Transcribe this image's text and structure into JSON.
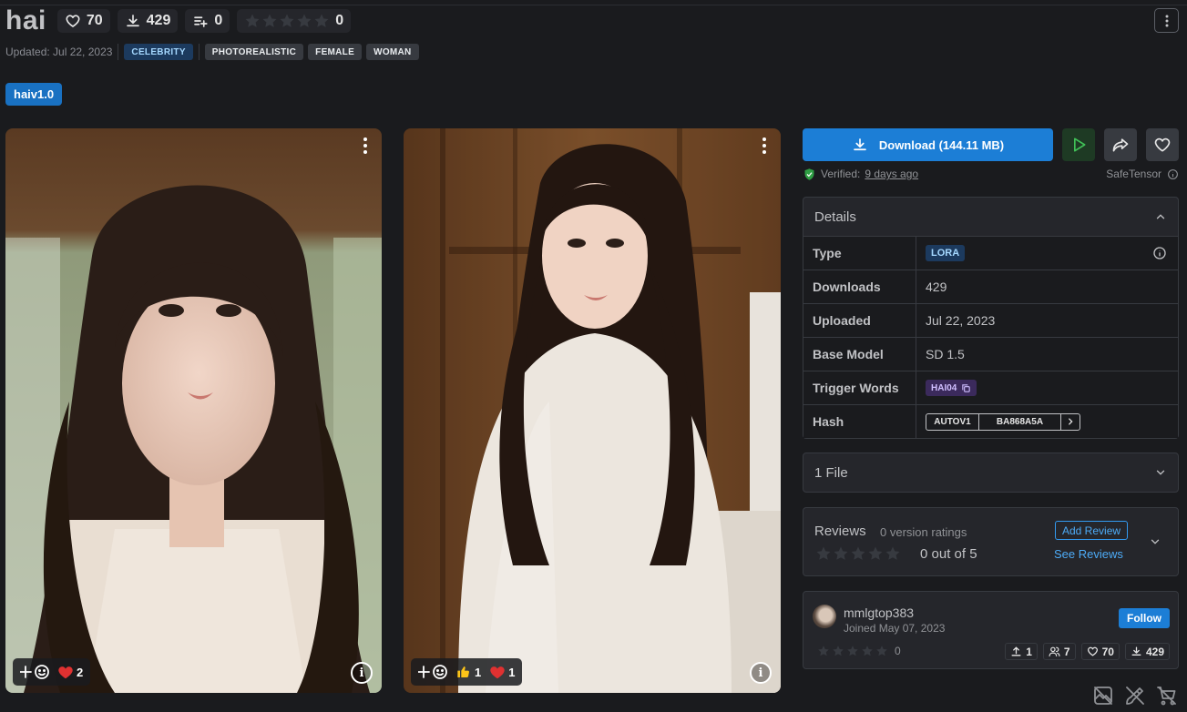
{
  "model": {
    "title": "hai",
    "likes": "70",
    "downloads": "429",
    "collections": "0",
    "rating_count": "0",
    "updated": "Updated: Jul 22, 2023",
    "tags": [
      "CELEBRITY",
      "PHOTOREALISTIC",
      "FEMALE",
      "WOMAN"
    ]
  },
  "version": {
    "label": "haiv1.0"
  },
  "images": [
    {
      "reactions": [
        {
          "icon": "heart-icon",
          "count": "2"
        }
      ]
    },
    {
      "reactions": [
        {
          "icon": "thumbs-up-icon",
          "count": "1"
        },
        {
          "icon": "heart-icon",
          "count": "1"
        }
      ]
    }
  ],
  "download": {
    "label": "Download (144.11 MB)",
    "verified_prefix": "Verified:",
    "verified_when": "9 days ago",
    "format": "SafeTensor"
  },
  "details": {
    "heading": "Details",
    "rows": {
      "type_key": "Type",
      "type_val": "LORA",
      "downloads_key": "Downloads",
      "downloads_val": "429",
      "uploaded_key": "Uploaded",
      "uploaded_val": "Jul 22, 2023",
      "base_key": "Base Model",
      "base_val": "SD 1.5",
      "trigger_key": "Trigger Words",
      "trigger_val": "HAI04",
      "hash_key": "Hash",
      "hash_type": "AUTOV1",
      "hash_val": "BA868A5A"
    }
  },
  "files": {
    "heading": "1 File"
  },
  "reviews": {
    "heading": "Reviews",
    "count": "0 version ratings",
    "score": "0 out of 5",
    "add": "Add Review",
    "see": "See Reviews"
  },
  "creator": {
    "name": "mmlgtop383",
    "joined": "Joined May 07, 2023",
    "follow": "Follow",
    "rating": "0",
    "uploads": "1",
    "followers": "7",
    "likes": "70",
    "downloads": "429"
  },
  "colors": {
    "background": "#1a1b1e",
    "panel": "#25262b",
    "accent": "#1c7ed6",
    "link": "#4dabf7",
    "run_button": "#2f9e44"
  }
}
